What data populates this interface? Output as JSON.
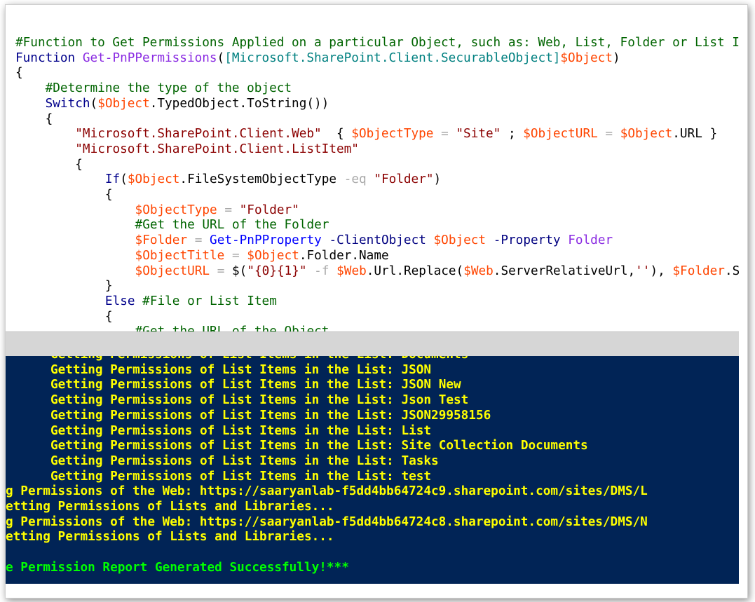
{
  "editor": {
    "lines": [
      {
        "indent": 0,
        "tokens": [
          {
            "t": "#Function to Get Permissions Applied on a particular Object, such as: Web, List, Folder or List Item",
            "c": "cmt"
          }
        ]
      },
      {
        "indent": 0,
        "tokens": [
          {
            "t": "Function",
            "c": "kw"
          },
          {
            "t": " ",
            "c": "pln"
          },
          {
            "t": "Get-PnPPermissions",
            "c": "pur"
          },
          {
            "t": "(",
            "c": "pln"
          },
          {
            "t": "[Microsoft.SharePoint.Client.SecurableObject]",
            "c": "typ"
          },
          {
            "t": "$Object",
            "c": "var"
          },
          {
            "t": ")",
            "c": "pln"
          }
        ]
      },
      {
        "indent": 0,
        "tokens": [
          {
            "t": "{",
            "c": "pln"
          }
        ]
      },
      {
        "indent": 1,
        "tokens": [
          {
            "t": "#Determine the type of the object",
            "c": "cmt"
          }
        ]
      },
      {
        "indent": 1,
        "tokens": [
          {
            "t": "Switch",
            "c": "kw"
          },
          {
            "t": "(",
            "c": "pln"
          },
          {
            "t": "$Object",
            "c": "var"
          },
          {
            "t": ".TypedObject.ToString())",
            "c": "pln"
          }
        ]
      },
      {
        "indent": 1,
        "tokens": [
          {
            "t": "{",
            "c": "pln"
          }
        ]
      },
      {
        "indent": 2,
        "tokens": [
          {
            "t": "\"Microsoft.SharePoint.Client.Web\"",
            "c": "str"
          },
          {
            "t": "  { ",
            "c": "pln"
          },
          {
            "t": "$ObjectType",
            "c": "var"
          },
          {
            "t": " = ",
            "c": "op"
          },
          {
            "t": "\"Site\"",
            "c": "str"
          },
          {
            "t": " ; ",
            "c": "pln"
          },
          {
            "t": "$ObjectURL",
            "c": "var"
          },
          {
            "t": " = ",
            "c": "op"
          },
          {
            "t": "$Object",
            "c": "var"
          },
          {
            "t": ".URL }",
            "c": "pln"
          }
        ]
      },
      {
        "indent": 2,
        "tokens": [
          {
            "t": "\"Microsoft.SharePoint.Client.ListItem\"",
            "c": "str"
          }
        ]
      },
      {
        "indent": 2,
        "tokens": [
          {
            "t": "{",
            "c": "pln"
          }
        ]
      },
      {
        "indent": 3,
        "tokens": [
          {
            "t": "If",
            "c": "kw"
          },
          {
            "t": "(",
            "c": "pln"
          },
          {
            "t": "$Object",
            "c": "var"
          },
          {
            "t": ".FileSystemObjectType ",
            "c": "pln"
          },
          {
            "t": "-eq",
            "c": "op"
          },
          {
            "t": " ",
            "c": "pln"
          },
          {
            "t": "\"Folder\"",
            "c": "str"
          },
          {
            "t": ")",
            "c": "pln"
          }
        ]
      },
      {
        "indent": 3,
        "tokens": [
          {
            "t": "{",
            "c": "pln"
          }
        ]
      },
      {
        "indent": 4,
        "tokens": [
          {
            "t": "$ObjectType",
            "c": "var"
          },
          {
            "t": " = ",
            "c": "op"
          },
          {
            "t": "\"Folder\"",
            "c": "str"
          }
        ]
      },
      {
        "indent": 4,
        "tokens": [
          {
            "t": "#Get the URL of the Folder",
            "c": "cmt"
          }
        ]
      },
      {
        "indent": 4,
        "tokens": [
          {
            "t": "$Folder",
            "c": "var"
          },
          {
            "t": " = ",
            "c": "op"
          },
          {
            "t": "Get-PnPProperty",
            "c": "fn"
          },
          {
            "t": " ",
            "c": "pln"
          },
          {
            "t": "-ClientObject",
            "c": "prm"
          },
          {
            "t": " ",
            "c": "pln"
          },
          {
            "t": "$Object",
            "c": "var"
          },
          {
            "t": " ",
            "c": "pln"
          },
          {
            "t": "-Property",
            "c": "prm"
          },
          {
            "t": " ",
            "c": "pln"
          },
          {
            "t": "Folder",
            "c": "pur"
          }
        ]
      },
      {
        "indent": 4,
        "tokens": [
          {
            "t": "$ObjectTitle",
            "c": "var"
          },
          {
            "t": " = ",
            "c": "op"
          },
          {
            "t": "$Object",
            "c": "var"
          },
          {
            "t": ".Folder.Name",
            "c": "pln"
          }
        ]
      },
      {
        "indent": 4,
        "tokens": [
          {
            "t": "$ObjectURL",
            "c": "var"
          },
          {
            "t": " = ",
            "c": "op"
          },
          {
            "t": "$(",
            "c": "pln"
          },
          {
            "t": "\"{0}{1}\"",
            "c": "str"
          },
          {
            "t": " ",
            "c": "pln"
          },
          {
            "t": "-f",
            "c": "op"
          },
          {
            "t": " ",
            "c": "pln"
          },
          {
            "t": "$Web",
            "c": "var"
          },
          {
            "t": ".Url.Replace(",
            "c": "pln"
          },
          {
            "t": "$Web",
            "c": "var"
          },
          {
            "t": ".ServerRelativeUrl,",
            "c": "pln"
          },
          {
            "t": "''",
            "c": "str"
          },
          {
            "t": "), ",
            "c": "pln"
          },
          {
            "t": "$Folder",
            "c": "var"
          },
          {
            "t": ".ServerRelativeUrl)",
            "c": "pln"
          }
        ]
      },
      {
        "indent": 3,
        "tokens": [
          {
            "t": "}",
            "c": "pln"
          }
        ]
      },
      {
        "indent": 3,
        "tokens": [
          {
            "t": "Else",
            "c": "kw"
          },
          {
            "t": " ",
            "c": "pln"
          },
          {
            "t": "#File or List Item",
            "c": "cmt"
          }
        ]
      },
      {
        "indent": 3,
        "tokens": [
          {
            "t": "{",
            "c": "pln"
          }
        ]
      },
      {
        "indent": 4,
        "tokens": [
          {
            "t": "#Get the URL of the Object",
            "c": "cmt"
          }
        ]
      }
    ]
  },
  "console": {
    "lines": [
      {
        "indent": 4,
        "text": "Getting Permissions of List Items in the List: Documents",
        "kind": "yellow"
      },
      {
        "indent": 4,
        "text": "Getting Permissions of List Items in the List: JSON",
        "kind": "yellow"
      },
      {
        "indent": 4,
        "text": "Getting Permissions of List Items in the List: JSON New",
        "kind": "yellow"
      },
      {
        "indent": 4,
        "text": "Getting Permissions of List Items in the List: Json Test",
        "kind": "yellow"
      },
      {
        "indent": 4,
        "text": "Getting Permissions of List Items in the List: JSON29958156",
        "kind": "yellow"
      },
      {
        "indent": 4,
        "text": "Getting Permissions of List Items in the List: List",
        "kind": "yellow"
      },
      {
        "indent": 4,
        "text": "Getting Permissions of List Items in the List: Site Collection Documents",
        "kind": "yellow"
      },
      {
        "indent": 4,
        "text": "Getting Permissions of List Items in the List: Tasks",
        "kind": "yellow"
      },
      {
        "indent": 4,
        "text": "Getting Permissions of List Items in the List: test",
        "kind": "yellow"
      },
      {
        "indent": 0,
        "text": "g Permissions of the Web: https://saaryanlab-f5dd4bb64724c9.sharepoint.com/sites/DMS/L",
        "kind": "yellow"
      },
      {
        "indent": 0,
        "text": "etting Permissions of Lists and Libraries...",
        "kind": "yellow"
      },
      {
        "indent": 0,
        "text": "g Permissions of the Web: https://saaryanlab-f5dd4bb64724c8.sharepoint.com/sites/DMS/N",
        "kind": "yellow"
      },
      {
        "indent": 0,
        "text": "etting Permissions of Lists and Libraries...",
        "kind": "yellow"
      },
      {
        "indent": 0,
        "text": "",
        "kind": "yellow"
      },
      {
        "indent": 0,
        "text": "e Permission Report Generated Successfully!***",
        "kind": "success"
      }
    ]
  },
  "colors": {
    "console_bg": "#012456",
    "console_text": "#ffff00",
    "console_success": "#00ff00",
    "comment": "#006400",
    "keyword": "#00008b",
    "variable": "#ff4500",
    "string": "#8b0000",
    "type": "#008080"
  }
}
